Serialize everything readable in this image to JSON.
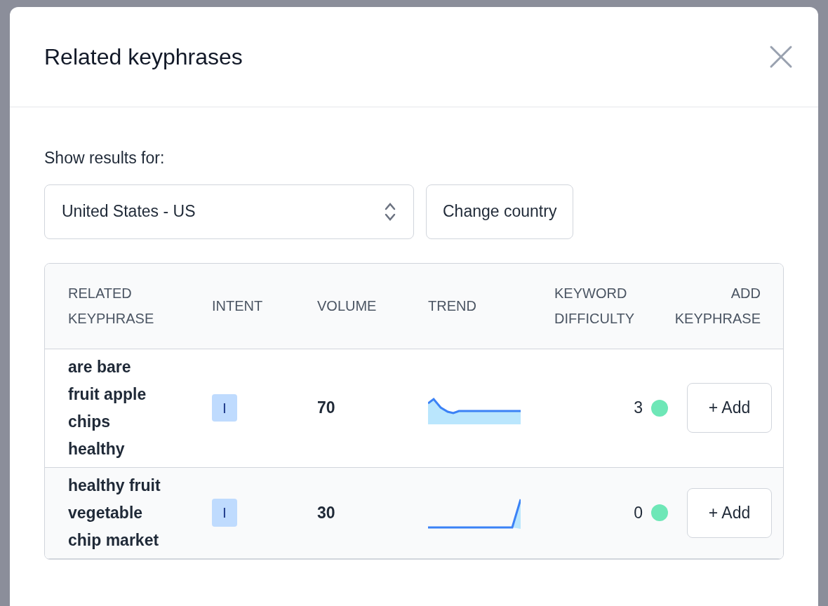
{
  "dialog": {
    "title": "Related keyphrases"
  },
  "filter": {
    "label": "Show results for:",
    "country": "United States - US",
    "button": "Change country"
  },
  "table": {
    "columns": [
      "RELATED KEYPHRASE",
      "INTENT",
      "VOLUME",
      "TREND",
      "KEYWORD DIFFICULTY",
      "ADD KEYPHRASE"
    ],
    "rows": [
      {
        "keyphrase": "are bare fruit apple chips healthy",
        "intent": "I",
        "volume": "70",
        "trend": {
          "kind": "dip"
        },
        "difficulty": "3",
        "color": "#6ee7b7",
        "action": "+ Add"
      },
      {
        "keyphrase": "healthy fruit vegetable chip market",
        "intent": "I",
        "volume": "30",
        "trend": {
          "kind": "spike"
        },
        "difficulty": "0",
        "color": "#6ee7b7",
        "action": "+ Add"
      }
    ]
  }
}
